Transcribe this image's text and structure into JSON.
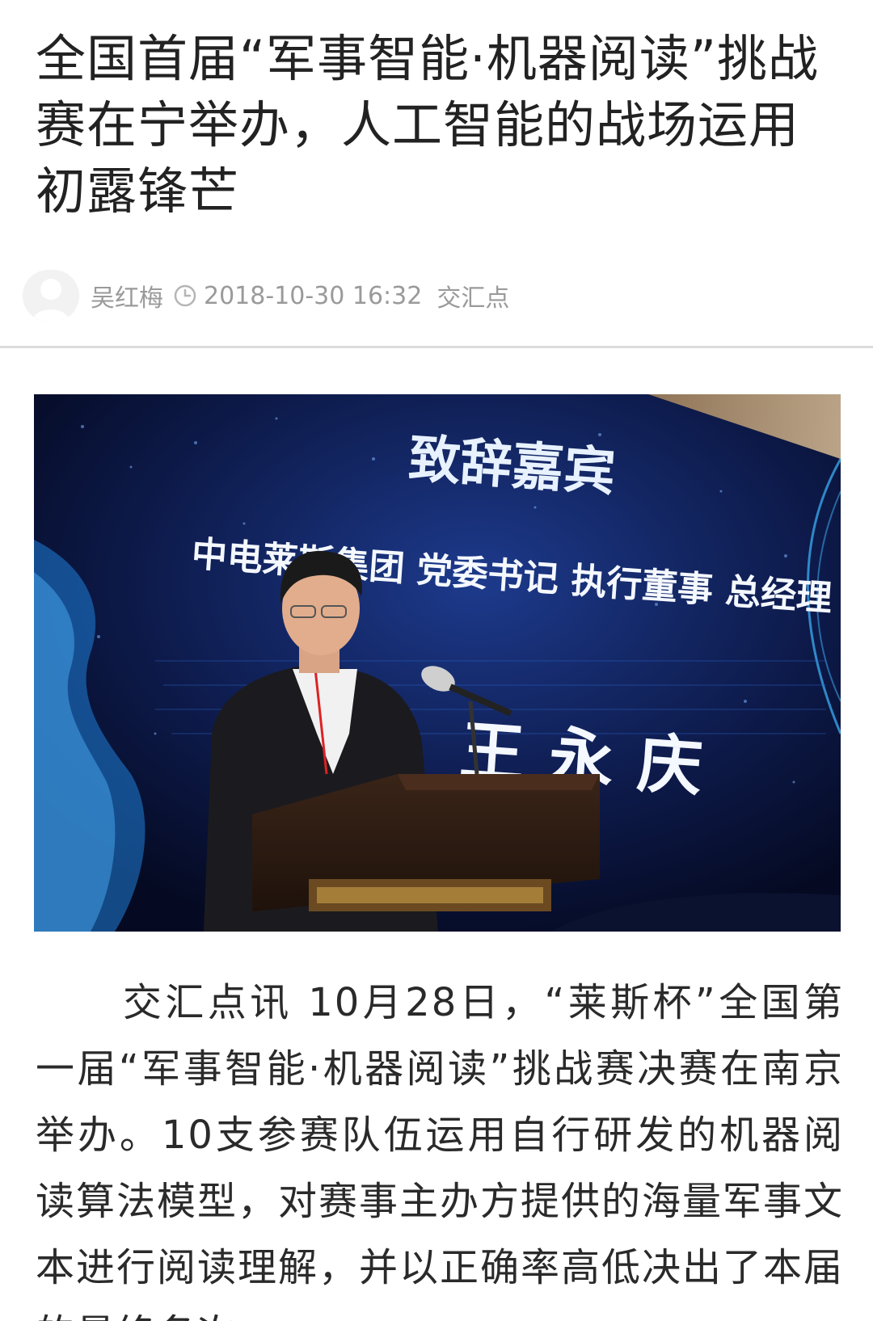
{
  "article": {
    "title": "全国首届“军事智能·机器阅读”挑战赛在宁举办，人工智能的战场运用初露锋芒",
    "author": "吴红梅",
    "datetime": "2018-10-30 16:32",
    "source": "交汇点",
    "body": "交汇点讯 10月28日，“莱斯杯”全国第一届“军事智能·机器阅读”挑战赛决赛在南京举办。10支参赛队伍运用自行研发的机器阅读算法模型，对赛事主办方提供的海量军事文本进行阅读理解，并以正确率高低决出了本届的最终名次"
  },
  "photo": {
    "screen_heading": "致辞嘉宾",
    "screen_subtitle": "中电莱斯集团 党委书记 执行董事 总经理",
    "screen_name": "王永庆"
  },
  "icons": {
    "avatar": "user-avatar-icon",
    "clock": "clock-icon"
  },
  "colors": {
    "meta_text": "#9a9a9a",
    "divider": "#dcdcdc",
    "screen_bg": "#0b1437"
  }
}
